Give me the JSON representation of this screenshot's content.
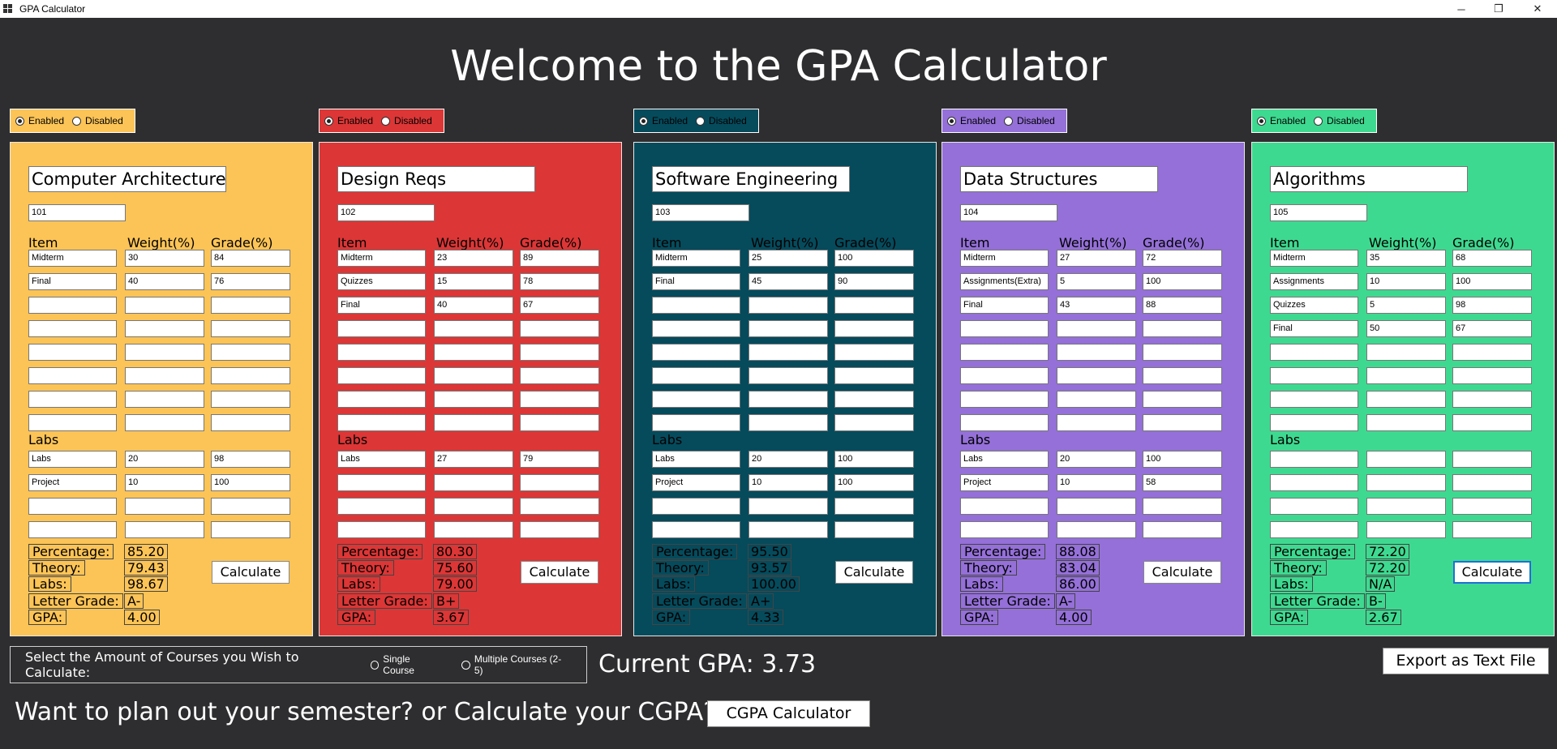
{
  "window": {
    "title": "GPA Calculator",
    "min": "─",
    "restore": "❐",
    "close": "✕"
  },
  "welcome": "Welcome to the GPA Calculator",
  "radio": {
    "enabled": "Enabled",
    "disabled": "Disabled"
  },
  "headers": {
    "item": "Item",
    "weight": "Weight(%)",
    "grade": "Grade(%)",
    "labs": "Labs"
  },
  "stats": {
    "percentage": "Percentage:",
    "theory": "Theory:",
    "labs": "Labs:",
    "letter": "Letter Grade:",
    "gpa": "GPA:"
  },
  "calculate": "Calculate",
  "colors": {
    "c1": "#fcc456",
    "c2": "#dc3636",
    "c3": "#054b5c",
    "c4": "#9470d8",
    "c5": "#3ed990",
    "background": "#2e2d2f"
  },
  "courses": [
    {
      "name": "Computer Architecture",
      "code": "101",
      "items": [
        [
          "Midterm",
          "30",
          "84"
        ],
        [
          "Final",
          "40",
          "76"
        ],
        [
          "",
          "",
          ""
        ],
        [
          "",
          "",
          ""
        ],
        [
          "",
          "",
          ""
        ],
        [
          "",
          "",
          ""
        ],
        [
          "",
          "",
          ""
        ],
        [
          "",
          "",
          ""
        ]
      ],
      "labs": [
        [
          "Labs",
          "20",
          "98"
        ],
        [
          "Project",
          "10",
          "100"
        ],
        [
          "",
          "",
          ""
        ],
        [
          "",
          "",
          ""
        ]
      ],
      "percentage": "85.20",
      "theory": "79.43",
      "labs_score": "98.67",
      "letter": "A-",
      "gpa": "4.00"
    },
    {
      "name": "Design Reqs",
      "code": "102",
      "items": [
        [
          "Midterm",
          "23",
          "89"
        ],
        [
          "Quizzes",
          "15",
          "78"
        ],
        [
          "Final",
          "40",
          "67"
        ],
        [
          "",
          "",
          ""
        ],
        [
          "",
          "",
          ""
        ],
        [
          "",
          "",
          ""
        ],
        [
          "",
          "",
          ""
        ],
        [
          "",
          "",
          ""
        ]
      ],
      "labs": [
        [
          "Labs",
          "27",
          "79"
        ],
        [
          "",
          "",
          ""
        ],
        [
          "",
          "",
          ""
        ],
        [
          "",
          "",
          ""
        ]
      ],
      "percentage": "80.30",
      "theory": "75.60",
      "labs_score": "79.00",
      "letter": "B+",
      "gpa": "3.67"
    },
    {
      "name": "Software Engineering",
      "code": "103",
      "items": [
        [
          "Midterm",
          "25",
          "100"
        ],
        [
          "Final",
          "45",
          "90"
        ],
        [
          "",
          "",
          ""
        ],
        [
          "",
          "",
          ""
        ],
        [
          "",
          "",
          ""
        ],
        [
          "",
          "",
          ""
        ],
        [
          "",
          "",
          ""
        ],
        [
          "",
          "",
          ""
        ]
      ],
      "labs": [
        [
          "Labs",
          "20",
          "100"
        ],
        [
          "Project",
          "10",
          "100"
        ],
        [
          "",
          "",
          ""
        ],
        [
          "",
          "",
          ""
        ]
      ],
      "percentage": "95.50",
      "theory": "93.57",
      "labs_score": "100.00",
      "letter": "A+",
      "gpa": "4.33"
    },
    {
      "name": "Data Structures",
      "code": "104",
      "items": [
        [
          "Midterm",
          "27",
          "72"
        ],
        [
          "Assignments(Extra)",
          "5",
          "100"
        ],
        [
          "Final",
          "43",
          "88"
        ],
        [
          "",
          "",
          ""
        ],
        [
          "",
          "",
          ""
        ],
        [
          "",
          "",
          ""
        ],
        [
          "",
          "",
          ""
        ],
        [
          "",
          "",
          ""
        ]
      ],
      "labs": [
        [
          "Labs",
          "20",
          "100"
        ],
        [
          "Project",
          "10",
          "58"
        ],
        [
          "",
          "",
          ""
        ],
        [
          "",
          "",
          ""
        ]
      ],
      "percentage": "88.08",
      "theory": "83.04",
      "labs_score": "86.00",
      "letter": "A-",
      "gpa": "4.00"
    },
    {
      "name": "Algorithms",
      "code": "105",
      "items": [
        [
          "Midterm",
          "35",
          "68"
        ],
        [
          "Assignments",
          "10",
          "100"
        ],
        [
          "Quizzes",
          "5",
          "98"
        ],
        [
          "Final",
          "50",
          "67"
        ],
        [
          "",
          "",
          ""
        ],
        [
          "",
          "",
          ""
        ],
        [
          "",
          "",
          ""
        ],
        [
          "",
          "",
          ""
        ]
      ],
      "labs": [
        [
          "",
          "",
          ""
        ],
        [
          "",
          "",
          ""
        ],
        [
          "",
          "",
          ""
        ],
        [
          "",
          "",
          ""
        ]
      ],
      "percentage": "72.20",
      "theory": "72.20",
      "labs_score": "N/A",
      "letter": "B-",
      "gpa": "2.67"
    }
  ],
  "select_question": "Select the Amount of Courses you Wish to Calculate:",
  "single_course": "Single Course",
  "multiple_courses": "Multiple Courses (2-5)",
  "current_gpa": "Current GPA:  3.73",
  "export": "Export as Text File",
  "plan_text": "Want to plan out your semester? or Calculate your CGPA?",
  "cgpa_button": "CGPA Calculator"
}
